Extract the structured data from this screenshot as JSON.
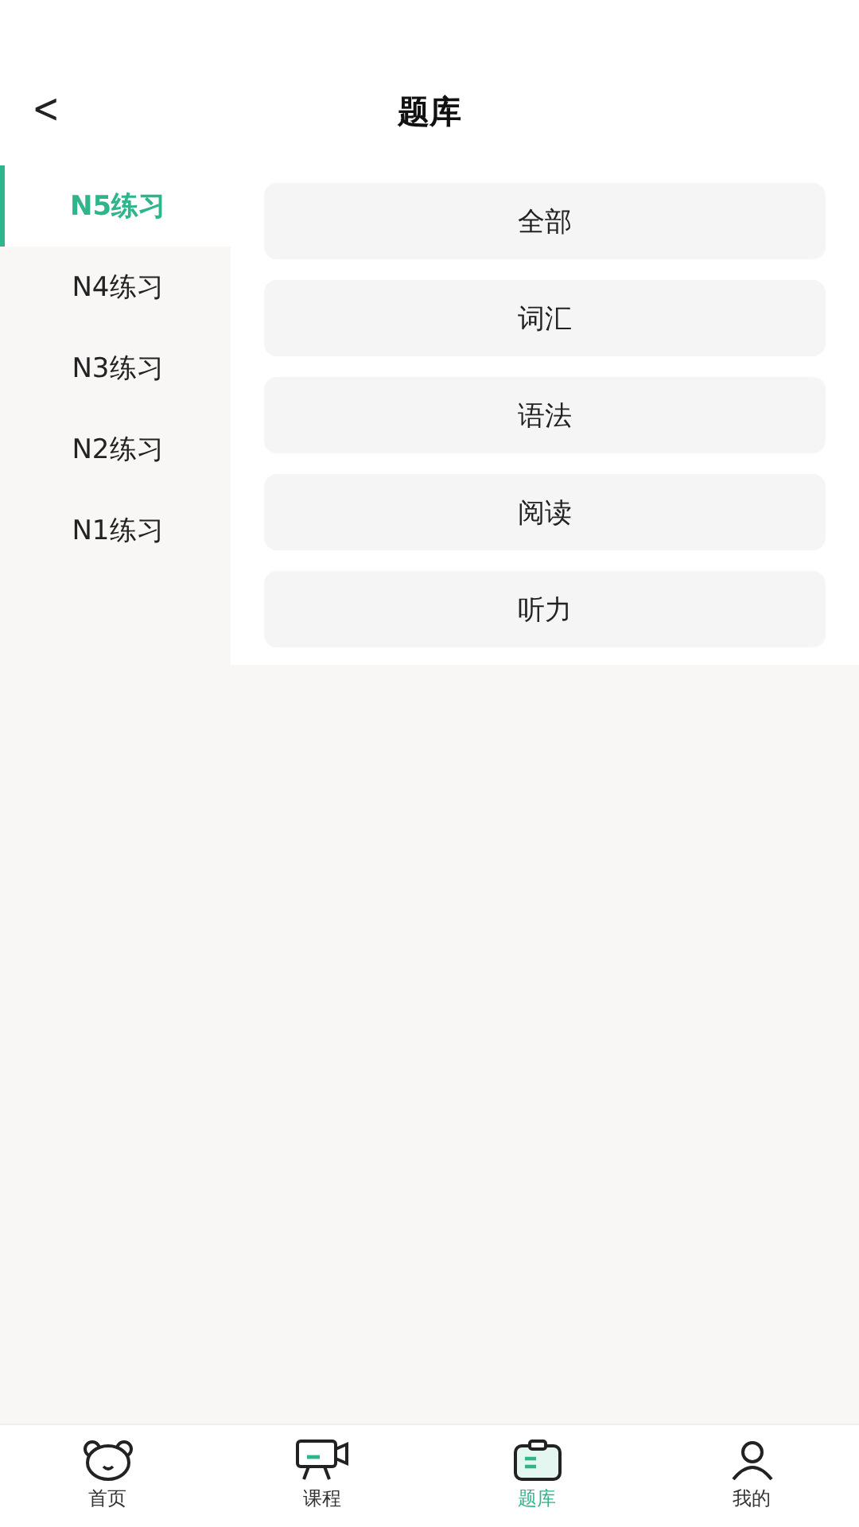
{
  "header": {
    "back": "<",
    "title": "题库"
  },
  "levels": [
    {
      "label": "N5练习",
      "selected": true
    },
    {
      "label": "N4练习",
      "selected": false
    },
    {
      "label": "N3练习",
      "selected": false
    },
    {
      "label": "N2练习",
      "selected": false
    },
    {
      "label": "N1练习",
      "selected": false
    }
  ],
  "categories": [
    "全部",
    "词汇",
    "语法",
    "阅读",
    "听力"
  ],
  "tab_bar": [
    {
      "label": "首页",
      "kind": "home",
      "selected": false
    },
    {
      "label": "课程",
      "kind": "course",
      "selected": false
    },
    {
      "label": "题库",
      "kind": "bank",
      "selected": true
    },
    {
      "label": "我的",
      "kind": "me",
      "selected": false
    }
  ]
}
